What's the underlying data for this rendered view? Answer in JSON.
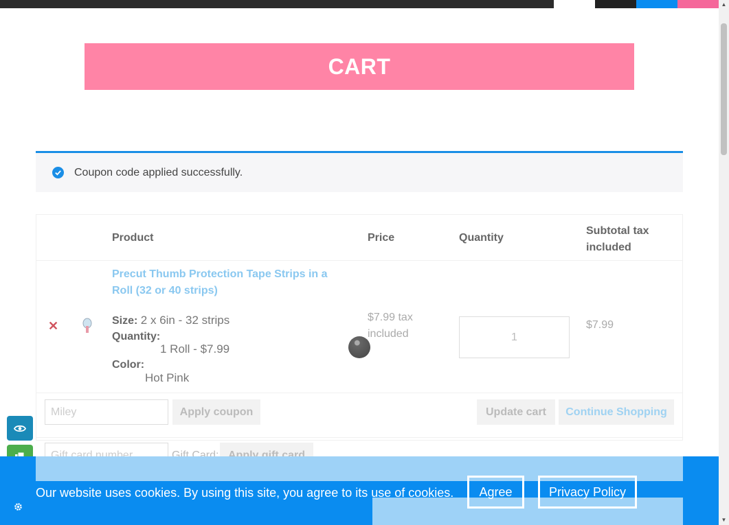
{
  "banner": {
    "title": "CART"
  },
  "notice": {
    "message": "Coupon code applied successfully."
  },
  "table": {
    "headers": {
      "product": "Product",
      "price": "Price",
      "quantity": "Quantity",
      "subtotal": "Subtotal tax included"
    },
    "items": [
      {
        "name": "Precut Thumb Protection Tape Strips in a Roll (32 or 40 strips)",
        "size_label": "Size:",
        "size_value": "2 x 6in - 32 strips",
        "quantity_label": "Quantity:",
        "quantity_value": "1 Roll - $7.99",
        "color_label": "Color:",
        "color_value": "Hot Pink",
        "price": "$7.99 tax included",
        "qty": "1",
        "subtotal": "$7.99"
      }
    ]
  },
  "actions": {
    "coupon_placeholder": "Miley",
    "apply_coupon": "Apply coupon",
    "update_cart": "Update cart",
    "continue_shopping": "Continue Shopping"
  },
  "gift": {
    "placeholder": "Gift card number",
    "label": "Gift Card:",
    "apply": "Apply gift card"
  },
  "cookie": {
    "message": "Our website uses cookies. By using this site, you agree to its use of cookies.",
    "agree": "Agree",
    "privacy": "Privacy Policy"
  },
  "colors": {
    "banner": "#ff84a6",
    "accent_blue": "#0a8cf0",
    "link": "#8ac8f0",
    "remove": "#d0545e"
  },
  "icons": [
    "check-circle-icon",
    "remove-x-icon",
    "eye-icon",
    "copy-icon",
    "gear-icon",
    "loading-spinner"
  ]
}
